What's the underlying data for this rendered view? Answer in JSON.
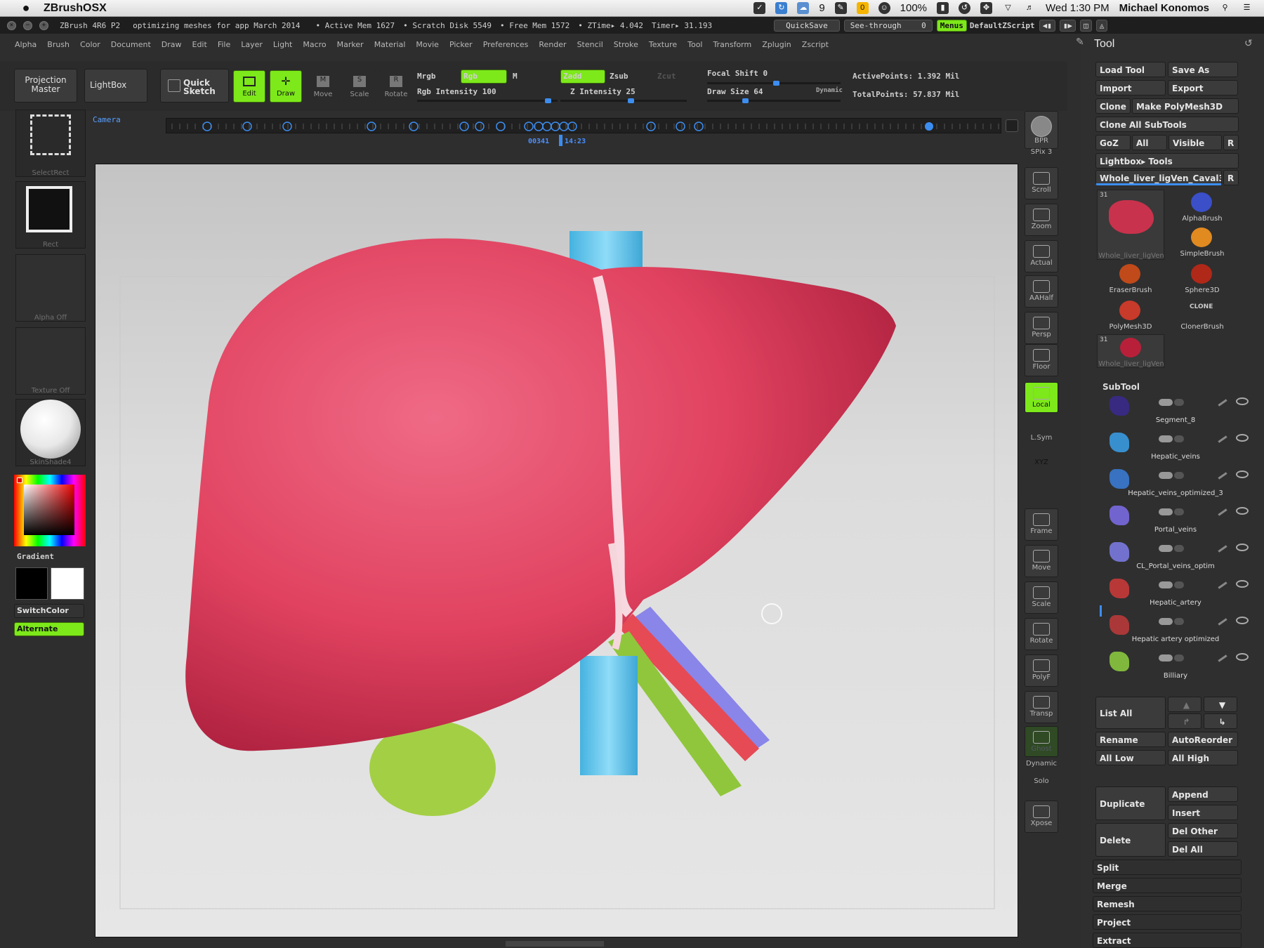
{
  "macbar": {
    "app_name": "ZBrushOSX",
    "battery_count": "9",
    "zoom_pct": "100%",
    "datetime": "Wed 1:30 PM",
    "user": "Michael Konomos"
  },
  "titlebar": {
    "app_version": "ZBrush 4R6 P2",
    "document": "optimizing meshes for app March 2014",
    "active_mem": "• Active Mem 1627",
    "scratch_disk": "• Scratch Disk 5549",
    "free_mem": "• Free Mem 1572",
    "ztime": "• ZTime▸ 4.042",
    "timer": "Timer▸ 31.193",
    "quicksave": "QuickSave",
    "see_through": "See-through",
    "see_through_value": "0",
    "menus_btn": "Menus",
    "default_script": "DefaultZScript"
  },
  "menus": [
    "Alpha",
    "Brush",
    "Color",
    "Document",
    "Draw",
    "Edit",
    "File",
    "Layer",
    "Light",
    "Macro",
    "Marker",
    "Material",
    "Movie",
    "Picker",
    "Preferences",
    "Render",
    "Stencil",
    "Stroke",
    "Texture",
    "Tool",
    "Transform",
    "Zplugin",
    "Zscript"
  ],
  "shelf": {
    "projection_master": "Projection Master",
    "lightbox": "LightBox",
    "quick_sketch": "Quick Sketch",
    "edit": "Edit",
    "draw": "Draw",
    "move": "Move",
    "scale": "Scale",
    "rotate": "Rotate",
    "mrgb": "Mrgb",
    "rgb": "Rgb",
    "m": "M",
    "rgb_intensity": "Rgb Intensity 100",
    "zadd": "Zadd",
    "zsub": "Zsub",
    "zcut": "Zcut",
    "z_intensity": "Z Intensity 25",
    "focal_shift": "Focal Shift 0",
    "draw_size": "Draw Size 64",
    "dynamic": "Dynamic",
    "active_points": "ActivePoints: 1.392 Mil",
    "total_points": "TotalPoints: 57.837 Mil",
    "camera": "Camera",
    "timeline_frame": "00341",
    "timeline_time": "14:23"
  },
  "leftpanel": {
    "select_rect": "SelectRect",
    "rect": "Rect",
    "alpha": "Alpha Off",
    "texture": "Texture Off",
    "material": "SkinShade4",
    "gradient": "Gradient",
    "switch_color": "SwitchColor",
    "alternate": "Alternate"
  },
  "rightshelf": [
    "BPR",
    "SPix 3",
    "Scroll",
    "Zoom",
    "Actual",
    "AAHalf",
    "Persp",
    "Floor",
    "Local",
    "L.Sym",
    "XYZ",
    "Frame",
    "Move",
    "Scale",
    "Rotate",
    "PolyF",
    "Transp",
    "Ghost",
    "Dynamic",
    "Solo",
    "Xpose"
  ],
  "tool": {
    "title": "Tool",
    "load_tool": "Load Tool",
    "save_as": "Save As",
    "import": "Import",
    "export": "Export",
    "clone": "Clone",
    "make_polymesh": "Make PolyMesh3D",
    "clone_all": "Clone All SubTools",
    "goz": "GoZ",
    "all": "All",
    "visible": "Visible",
    "r": "R",
    "lightbox_tools": "Lightbox▸ Tools",
    "current_tool": "Whole_liver_ligVen_Caval3",
    "thumbs": [
      {
        "name": "Whole_liver_ligVen",
        "badge": "31"
      },
      {
        "name": "AlphaBrush",
        "badge": ""
      },
      {
        "name": "SimpleBrush",
        "badge": ""
      },
      {
        "name": "EraserBrush",
        "badge": ""
      },
      {
        "name": "Sphere3D",
        "badge": ""
      },
      {
        "name": "PolyMesh3D",
        "badge": ""
      },
      {
        "name": "ClonerBrush",
        "badge": ""
      },
      {
        "name": "Whole_liver_ligVen",
        "badge": "31"
      }
    ],
    "clone_icon_text": "CLONE",
    "subtool_header": "SubTool",
    "subtools": [
      "Segment_8",
      "Hepatic_veins",
      "Hepatic_veins_optimized_3",
      "Portal_veins",
      "CL_Portal_veins_optim",
      "Hepatic_artery",
      "Hepatic artery optimized",
      "Billiary"
    ],
    "list_all": "List All",
    "rename": "Rename",
    "auto_reorder": "AutoReorder",
    "all_low": "All Low",
    "all_high": "All High",
    "duplicate": "Duplicate",
    "append": "Append",
    "insert": "Insert",
    "delete": "Delete",
    "del_other": "Del Other",
    "del_all": "Del All",
    "split": "Split",
    "merge": "Merge",
    "remesh": "Remesh",
    "project": "Project",
    "extract": "Extract"
  },
  "colors": {
    "accent_green": "#7de81a",
    "slider_blue": "#3c8df0",
    "liver": "#e0425f",
    "vena_cava": "#62c9ee",
    "gallbladder": "#a3cf45"
  }
}
